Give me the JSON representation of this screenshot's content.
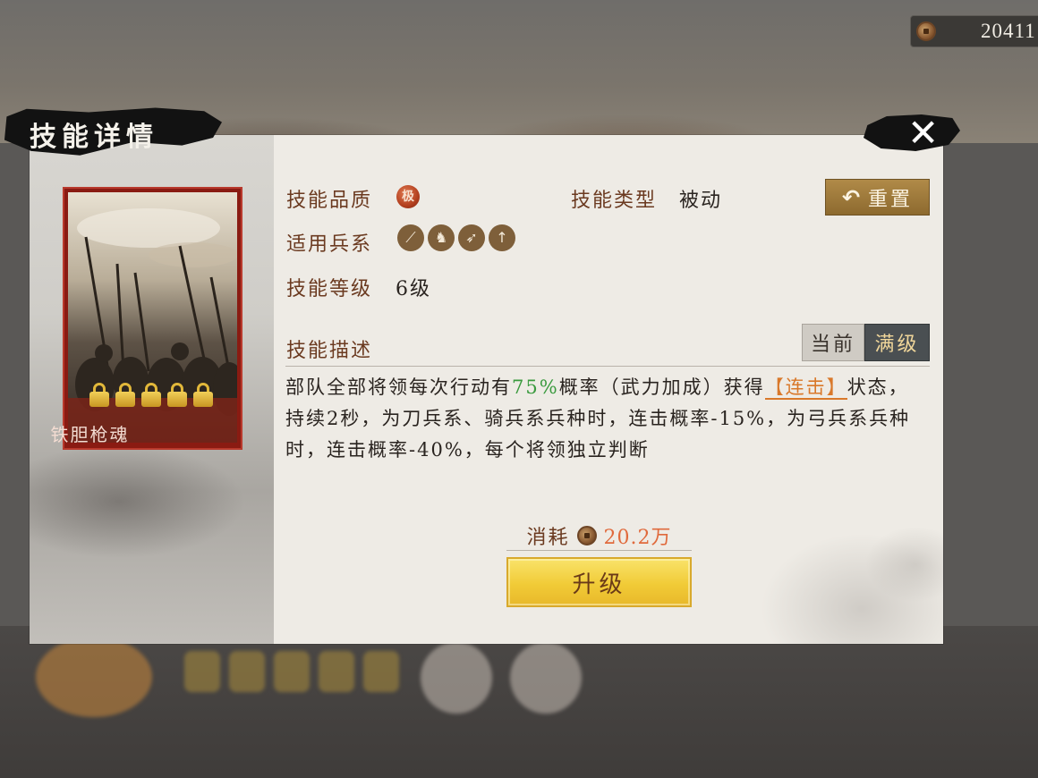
{
  "currency": {
    "icon": "copper-coin-icon",
    "value": "20411"
  },
  "dialog": {
    "title": "技能详情",
    "close_icon": "close-icon",
    "skill": {
      "name": "铁胆枪魂",
      "locks": 5,
      "quality_label": "技能品质",
      "quality_badge": "极",
      "type_label": "技能类型",
      "type_value": "被动",
      "troops_label": "适用兵系",
      "troop_icons": [
        "blade-icon",
        "horse-icon",
        "bow-icon",
        "spear-icon"
      ],
      "level_label": "技能等级",
      "level_value": "6级"
    },
    "reset_button": {
      "label": "重置",
      "icon": "undo-arrow-icon"
    },
    "description": {
      "label": "技能描述",
      "tabs": {
        "current": "当前",
        "max": "满级"
      },
      "text_part1": "部队全部将领每次行动有",
      "highlight_pct": "75%",
      "text_part2": "概率（武力加成）获得",
      "highlight_status": "【连击】",
      "text_part3": "状态，持续2秒，为刀兵系、骑兵系兵种时，连击概率-15%，为弓兵系兵种时，连击概率-40%，每个将领独立判断"
    },
    "cost": {
      "label": "消耗",
      "value": "20.2万"
    },
    "upgrade_button": "升级"
  },
  "colors": {
    "label_brown": "#6b3a20",
    "highlight_green": "#3a9a3e",
    "highlight_orange": "#d9782a",
    "cost_red": "#e06a3c",
    "upgrade_gold": "#f1cb37"
  }
}
